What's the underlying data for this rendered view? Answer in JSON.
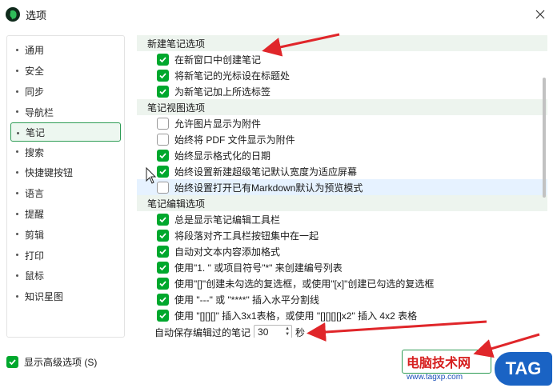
{
  "window": {
    "title": "选项",
    "app_icon": "evernote-elephant-icon",
    "close_icon": "close-icon"
  },
  "sidebar": {
    "items": [
      {
        "label": "通用",
        "active": false
      },
      {
        "label": "安全",
        "active": false
      },
      {
        "label": "同步",
        "active": false
      },
      {
        "label": "导航栏",
        "active": false
      },
      {
        "label": "笔记",
        "active": true
      },
      {
        "label": "搜索",
        "active": false
      },
      {
        "label": "快捷键按钮",
        "active": false
      },
      {
        "label": "语言",
        "active": false
      },
      {
        "label": "提醒",
        "active": false
      },
      {
        "label": "剪辑",
        "active": false
      },
      {
        "label": "打印",
        "active": false
      },
      {
        "label": "鼠标",
        "active": false
      },
      {
        "label": "知识星图",
        "active": false
      }
    ]
  },
  "sections": [
    {
      "header": "新建笔记选项",
      "options": [
        {
          "label": "在新窗口中创建笔记",
          "checked": true
        },
        {
          "label": "将新笔记的光标设在标题处",
          "checked": true
        },
        {
          "label": "为新笔记加上所选标签",
          "checked": true
        }
      ]
    },
    {
      "header": "笔记视图选项",
      "options": [
        {
          "label": "允许图片显示为附件",
          "checked": false
        },
        {
          "label": "始终将 PDF 文件显示为附件",
          "checked": false
        },
        {
          "label": "始终显示格式化的日期",
          "checked": true
        },
        {
          "label": "始终设置新建超级笔记默认宽度为适应屏幕",
          "checked": true
        },
        {
          "label": "始终设置打开已有Markdown默认为预览模式",
          "checked": false
        }
      ]
    },
    {
      "header": "笔记编辑选项",
      "options": [
        {
          "label": "总是显示笔记编辑工具栏",
          "checked": true
        },
        {
          "label": "将段落对齐工具栏按钮集中在一起",
          "checked": true
        },
        {
          "label": "自动对文本内容添加格式",
          "checked": true
        },
        {
          "label": "使用\"1. \" 或项目符号\"*\" 来创建编号列表",
          "checked": true
        },
        {
          "label": "使用\"[]\"创建未勾选的复选框，或使用\"[x]\"创建已勾选的复选框",
          "checked": true
        },
        {
          "label": "使用 \"---\" 或 \"****\" 插入水平分割线",
          "checked": true
        },
        {
          "label": "使用 \"[][][]\" 插入3x1表格，或使用 \"[][][][]x2\" 插入 4x2 表格",
          "checked": true
        }
      ]
    }
  ],
  "autosave": {
    "label": "自动保存编辑过的笔记",
    "value": "30",
    "unit": "秒"
  },
  "footer": {
    "advanced_label": "显示高级选项 (S)",
    "advanced_checked": true
  },
  "watermark": {
    "site_name": "电脑技术网",
    "url": "www.tagxp.com",
    "badge": "TAG"
  },
  "colors": {
    "accent_green": "#00a82d",
    "section_bg": "#edf4ee",
    "annotation_red": "#e0262a",
    "badge_blue": "#1a63c4"
  }
}
